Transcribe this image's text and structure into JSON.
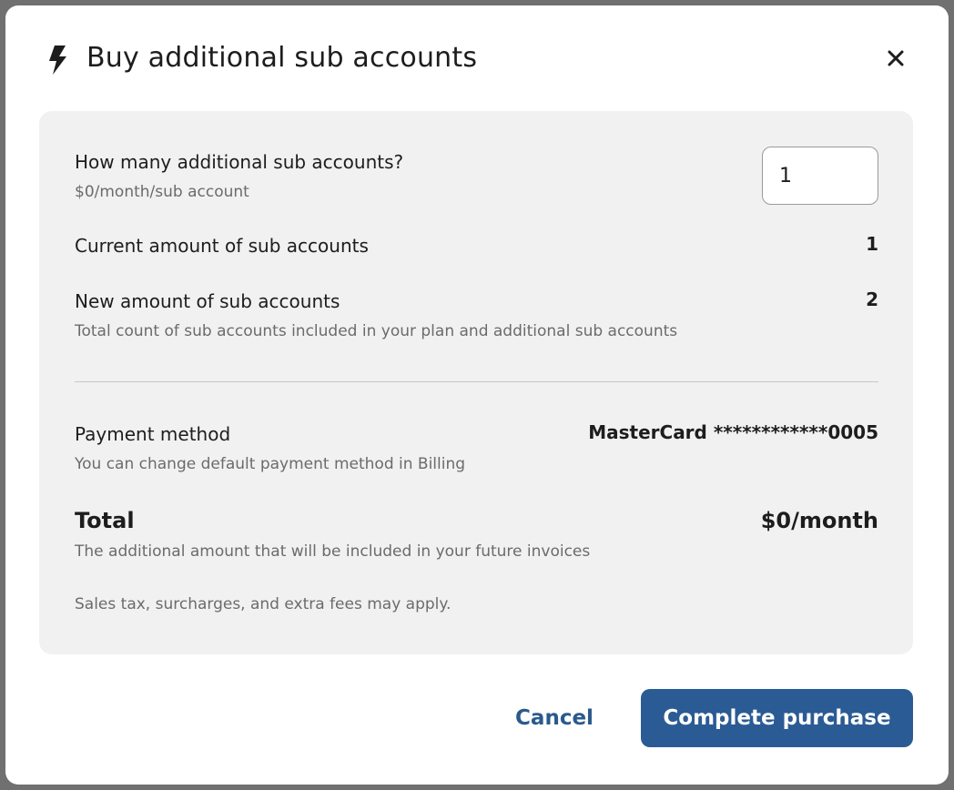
{
  "dialog": {
    "title": "Buy additional sub accounts"
  },
  "quantity": {
    "label": "How many additional sub accounts?",
    "price_note": "$0/month/sub account",
    "value": "1"
  },
  "current": {
    "label": "Current amount of sub accounts",
    "value": "1"
  },
  "new_amount": {
    "label": "New amount of sub accounts",
    "note": "Total count of sub accounts included in your plan and additional sub accounts",
    "value": "2"
  },
  "payment": {
    "label": "Payment method",
    "note": "You can change default payment method in Billing",
    "value": "MasterCard ************0005"
  },
  "total": {
    "label": "Total",
    "note": "The additional amount that will be included in your future invoices",
    "value": "$0/month",
    "tax_note": "Sales tax, surcharges, and extra fees may apply."
  },
  "actions": {
    "cancel_label": "Cancel",
    "complete_label": "Complete purchase"
  },
  "colors": {
    "primary": "#2b5b94",
    "link": "#2a5a8c",
    "panel": "#f1f1f1"
  },
  "icons": {
    "title": "lightning-bolt-icon",
    "close": "close-icon"
  }
}
